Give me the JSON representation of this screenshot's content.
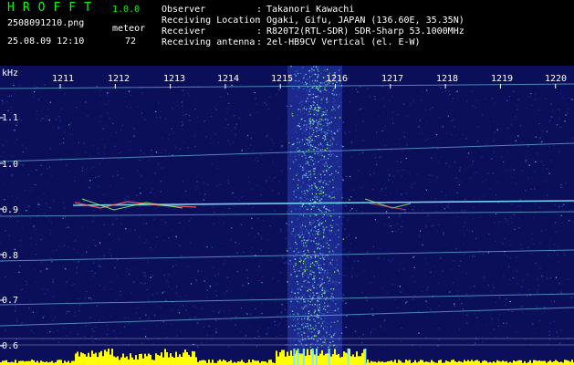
{
  "header": {
    "app_title": "HROFFT",
    "app_version": "1.0.0",
    "file_name": "2508091210.png",
    "datetime": "25.08.09 12:10",
    "meteor_label": "meteor",
    "meteor_count": "72",
    "fields": [
      {
        "key": "Observer",
        "value": "Takanori Kawachi"
      },
      {
        "key": "Receiving Location",
        "value": "Ogaki, Gifu, JAPAN (136.60E, 35.35N)"
      },
      {
        "key": "Receiver",
        "value": "R820T2(RTL-SDR) SDR-Sharp 53.1000MHz"
      },
      {
        "key": "Receiving antenna",
        "value": "2el-HB9CV Vertical (el. E-W)"
      }
    ]
  },
  "axes": {
    "y_unit": "kHz",
    "minute_labels": [
      "1211",
      "1212",
      "1213",
      "1214",
      "1215",
      "1216",
      "1217",
      "1218",
      "1219",
      "1220"
    ],
    "khz_labels": [
      "1.1",
      "1.0",
      "0.9",
      "0.8",
      "0.7",
      "0.6"
    ]
  },
  "colors": {
    "background": "#0b0f5a",
    "noise_light": "#3b5bd6",
    "signal_cyan": "#7fe9ff",
    "signal_green": "#9cff6a",
    "signal_red": "#ff6060",
    "level_yellow": "#ffff00",
    "header_green": "#00ff00"
  }
}
